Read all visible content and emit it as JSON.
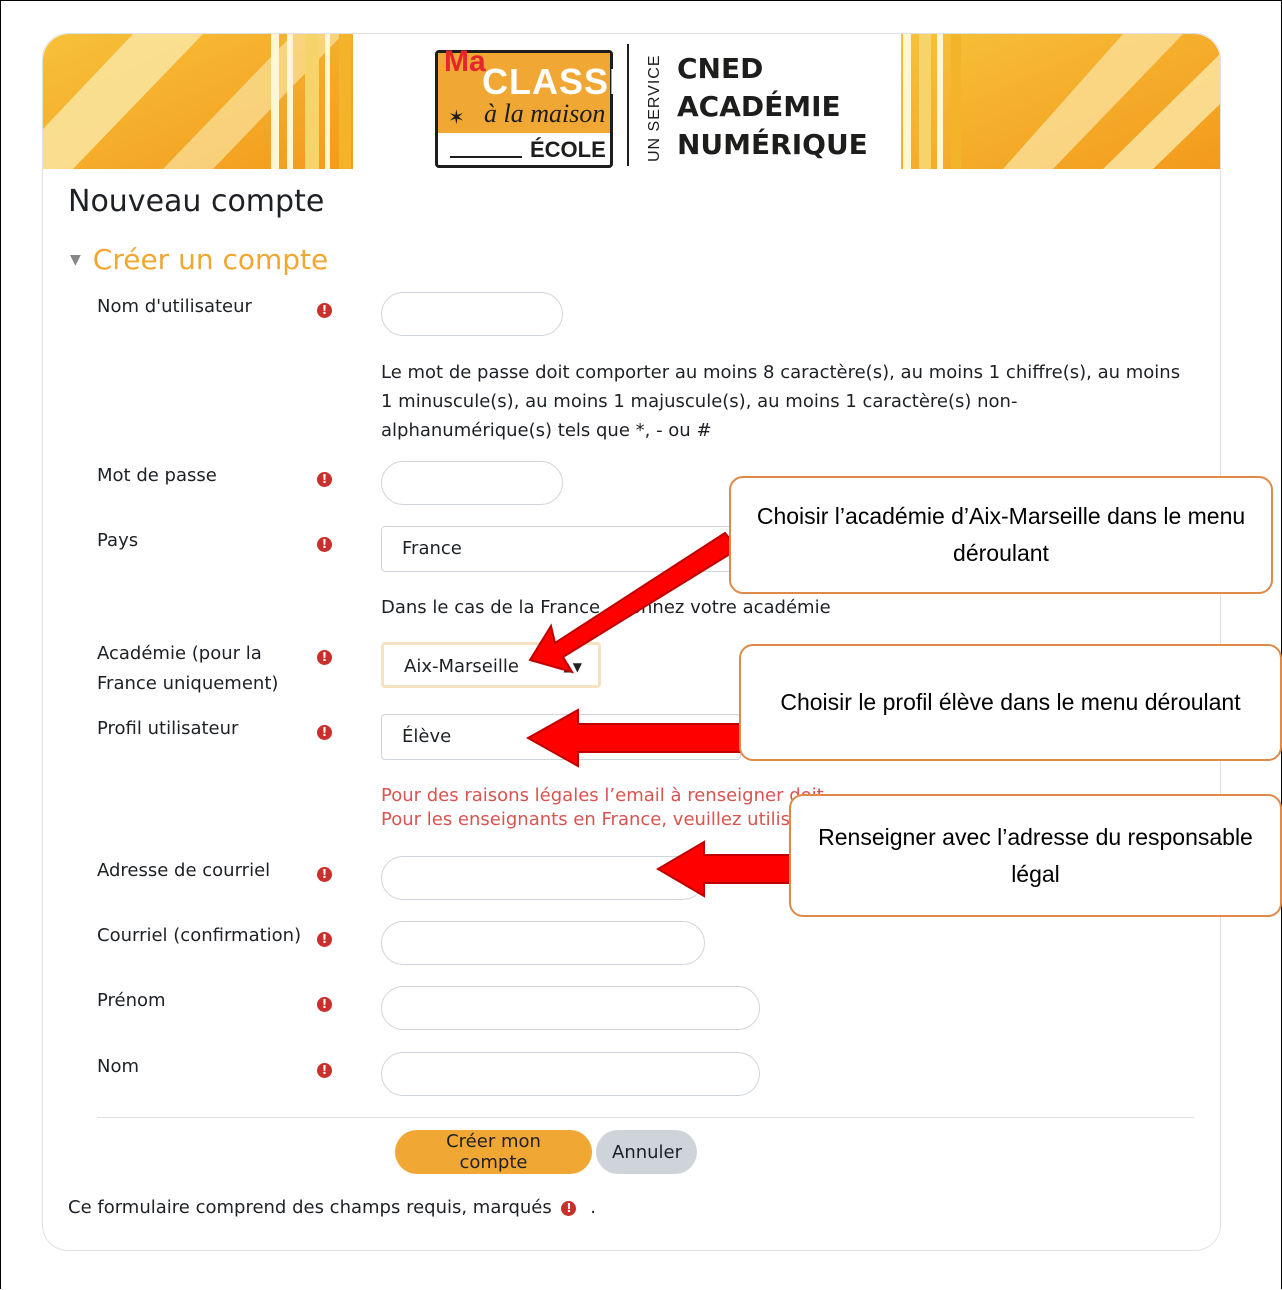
{
  "banner": {
    "logo": {
      "ma": "Ma",
      "classe": "CLASSE",
      "maison": "à la maison",
      "ecole": "ÉCOLE"
    },
    "service": "UN SERVICE",
    "cned_lines": [
      "CNED",
      "ACADÉMIE",
      "NUMÉRIQUE"
    ]
  },
  "page_title": "Nouveau compte",
  "section_title": "Créer un compte",
  "fields": {
    "username": {
      "label": "Nom d'utilisateur",
      "value": ""
    },
    "password_help": "Le mot de passe doit comporter au moins 8 caractère(s), au moins 1 chiffre(s), au moins 1 minuscule(s), au moins 1 majuscule(s), au moins 1 caractère(s) non-alphanumérique(s) tels que *, - ou #",
    "password": {
      "label": "Mot de passe",
      "value": ""
    },
    "country": {
      "label": "Pays",
      "value": "France"
    },
    "country_help": "Dans le cas de la France",
    "country_help_tail": "onnez votre académie",
    "academy": {
      "label_line1": "Académie (pour la",
      "label_line2": "France uniquement)",
      "value": "Aix-Marseille"
    },
    "profile": {
      "label": "Profil utilisateur",
      "value": "Élève"
    },
    "warn_line1": "Pour des raisons légales l’email à renseigner doit",
    "warn_line2": "Pour les enseignants en France, veuillez utiliser",
    "email": {
      "label": "Adresse de courriel",
      "value": ""
    },
    "email_confirm": {
      "label": "Courriel (confirmation)",
      "value": ""
    },
    "firstname": {
      "label": "Prénom",
      "value": ""
    },
    "lastname": {
      "label": "Nom",
      "value": ""
    }
  },
  "required_icon": "!",
  "buttons": {
    "submit": "Créer mon compte",
    "cancel": "Annuler"
  },
  "footer": {
    "text": "Ce formulaire comprend des champs requis, marqués",
    "suffix": "."
  },
  "callouts": {
    "academy": "Choisir l’académie d’Aix-Marseille dans le menu déroulant",
    "profile": "Choisir le profil élève dans le menu déroulant",
    "email": "Renseigner avec l’adresse du responsable légal"
  },
  "colors": {
    "accent": "#f0a733",
    "required": "#c9302c",
    "warning": "#d9534f",
    "arrow": "#ff0000",
    "callout_border": "#e08a4a"
  }
}
